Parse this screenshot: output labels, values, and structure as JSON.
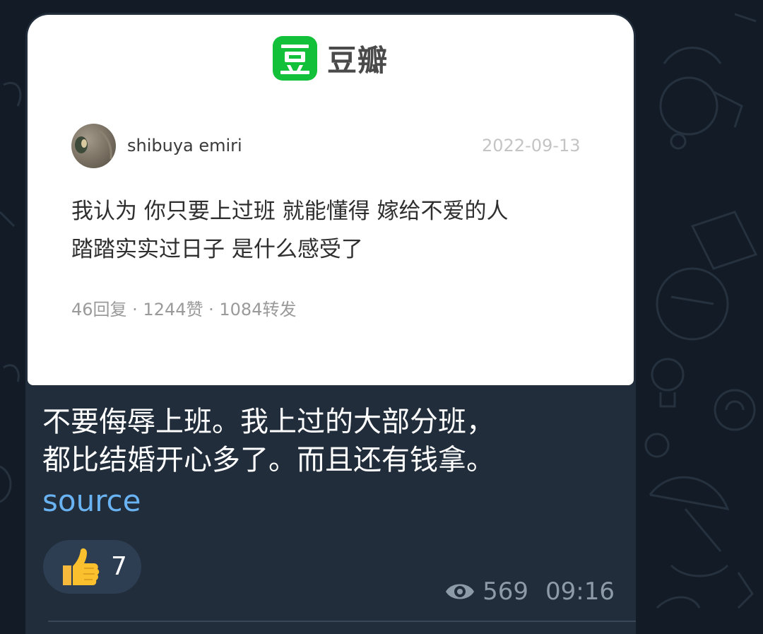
{
  "card": {
    "brand_name": "豆瓣",
    "brand_logo_char": "豆",
    "author": "shibuya emiri",
    "date": "2022-09-13",
    "quote_line1": "我认为 你只要上过班 就能懂得 嫁给不爱的人",
    "quote_line2": "踏踏实实过日子 是什么感受了",
    "stats": "46回复 · 1244赞 · 1084转发"
  },
  "message": {
    "line1": "不要侮辱上班。我上过的大部分班，",
    "line2": "都比结婚开心多了。而且还有钱拿。",
    "link": "source"
  },
  "reaction": {
    "emoji": "thumbs-up-icon",
    "count": "7"
  },
  "meta": {
    "views": "569",
    "time": "09:16"
  },
  "colors": {
    "brand_green": "#12c03a",
    "link_blue": "#6ab3f3",
    "bubble": "#212d3b"
  }
}
